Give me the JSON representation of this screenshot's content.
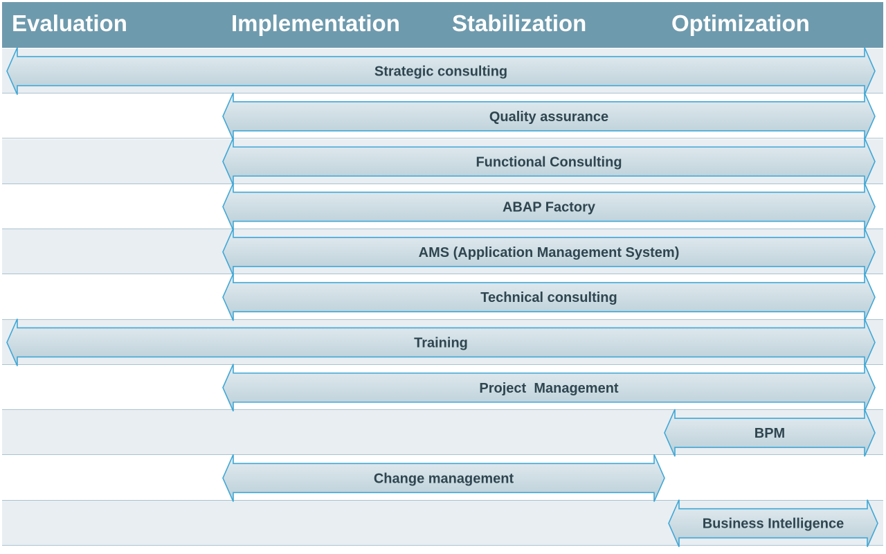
{
  "phases": {
    "evaluation": "Evaluation",
    "implementation": "Implementation",
    "stabilization": "Stabilization",
    "optimization": "Optimization"
  },
  "services": [
    {
      "label": "Strategic consulting",
      "from": "Evaluation",
      "to": "Optimization"
    },
    {
      "label": "Quality assurance",
      "from": "Implementation",
      "to": "Optimization"
    },
    {
      "label": "Functional Consulting",
      "from": "Implementation",
      "to": "Optimization"
    },
    {
      "label": "ABAP Factory",
      "from": "Implementation",
      "to": "Optimization"
    },
    {
      "label": "AMS (Application Management System)",
      "from": "Implementation",
      "to": "Optimization"
    },
    {
      "label": "Technical consulting",
      "from": "Implementation",
      "to": "Optimization"
    },
    {
      "label": "Training",
      "from": "Evaluation",
      "to": "Optimization"
    },
    {
      "label": "Project  Management",
      "from": "Implementation",
      "to": "Optimization"
    },
    {
      "label": "BPM",
      "from": "Optimization",
      "to": "Optimization"
    },
    {
      "label": "Change management",
      "from": "Implementation",
      "to": "Stabilization"
    },
    {
      "label": "Business Intelligence",
      "from": "Optimization",
      "to": "Optimization"
    }
  ],
  "colors": {
    "header": "#6e9aad",
    "arrow_stroke": "#3fa7d6",
    "arrow_fill_top": "#e6eef2",
    "arrow_fill_bottom": "#b9cdd6",
    "label": "#2f4650",
    "row_shaded": "#e9eef2"
  }
}
